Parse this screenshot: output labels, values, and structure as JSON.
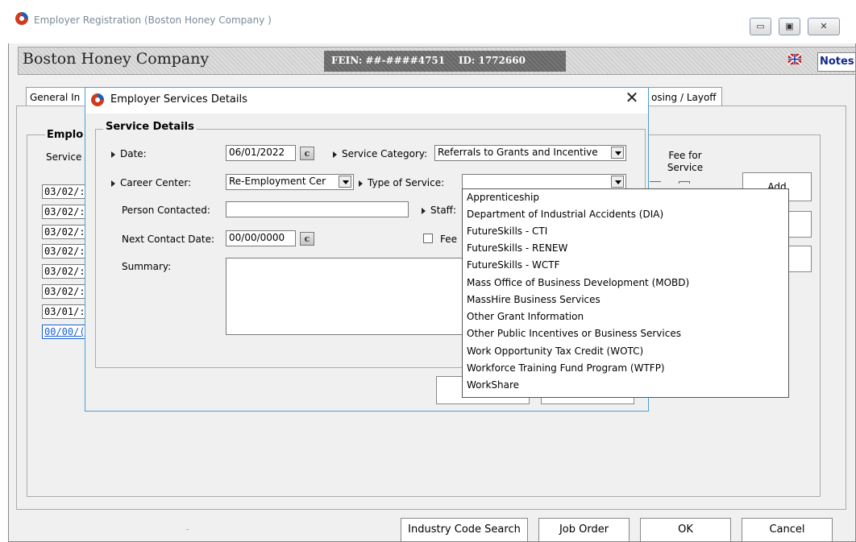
{
  "outer_window": {
    "title": "Employer Registration (Boston Honey Company )",
    "company_name": "Boston Honey Company",
    "fein": "FEIN: ##-####4751    ID: 1772660",
    "notes_label": "Notes",
    "window_buttons": {
      "minimize": "▭",
      "maximize": "▣",
      "close": "✕"
    }
  },
  "tabs": [
    {
      "label": "General In"
    },
    {
      "label": "osing / Layoff"
    }
  ],
  "employer_group": {
    "title": "Emplo",
    "service_col": "Service",
    "fee_header": "Fee for\nService",
    "rows": [
      "03/02/:",
      "03/02/:",
      "03/02/:",
      "03/02/:",
      "03/02/:",
      "03/02/:",
      "03/01/:",
      "00/00/("
    ],
    "add_button": "Add"
  },
  "bottom_bar": {
    "industry_code_search": "Industry Code Search",
    "job_order": "Job Order",
    "ok": "OK",
    "cancel": "Cancel"
  },
  "dialog": {
    "title": "Employer Services Details",
    "group_title": "Service Details",
    "date_label": "Date:",
    "date_value": "06/01/2022",
    "service_category_label": "Service Category:",
    "service_category_value": "Referrals to Grants and Incentive",
    "career_center_label": "Career Center:",
    "career_center_value": "Re-Employment Cer",
    "type_of_service_label": "Type of Service:",
    "type_of_service_value": "",
    "person_contacted_label": "Person Contacted:",
    "person_contacted_value": "",
    "staff_label": "Staff:",
    "next_contact_label": "Next Contact Date:",
    "next_contact_value": "00/00/0000",
    "fee_label": "Fee",
    "summary_label": "Summary:",
    "calendar_glyph": "c"
  },
  "type_of_service_options": [
    "Apprenticeship",
    "Department of Industrial Accidents (DIA)",
    "FutureSkills - CTI",
    "FutureSkills - RENEW",
    "FutureSkills - WCTF",
    "Mass Office of Business Development (MOBD)",
    "MassHire Business Services",
    "Other Grant Information",
    "Other Public Incentives or Business Services",
    "Work Opportunity Tax Credit (WOTC)",
    "Workforce Training Fund Program (WTFP)",
    "WorkShare"
  ],
  "colors": {
    "dialog_border": "#4a9fd5",
    "selected_row": "#1a5fd0"
  }
}
